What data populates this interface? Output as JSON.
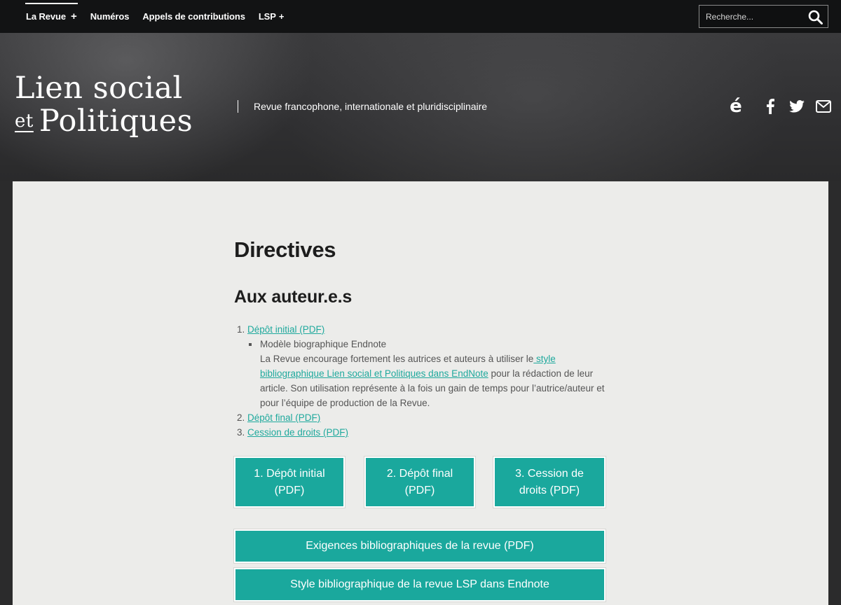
{
  "nav": {
    "items": [
      {
        "label": "La Revue",
        "plus": "+"
      },
      {
        "label": "Numéros"
      },
      {
        "label": "Appels de contributions"
      },
      {
        "label": "LSP",
        "plus": "+"
      }
    ]
  },
  "search": {
    "placeholder": "Recherche..."
  },
  "header": {
    "logo_line1": "Lien social",
    "logo_et": "et",
    "logo_line2": "Politiques",
    "tagline": "Revue francophone, internationale et pluridisciplinaire",
    "erudit_glyph": "é"
  },
  "content": {
    "title": "Directives",
    "subtitle": "Aux auteur.e.s",
    "list": [
      {
        "num": "1.",
        "link": "Dépôt initial (PDF)"
      },
      {
        "num": "2.",
        "link": "Dépôt final (PDF)"
      },
      {
        "num": "3.",
        "link": "Cession de droits (PDF)"
      }
    ],
    "sub_item": {
      "title": "Modèle biographique Endnote",
      "text_before": "La Revue encourage fortement les autrices et auteurs à utiliser le",
      "link": " style bibliographique Lien social et Politiques dans EndNote",
      "text_after": " pour la rédaction de leur article. Son utilisation représente à la fois un gain de temps pour l’autrice/auteur et pour l’équipe de production de la Revue."
    },
    "buttons": [
      "1. Dépôt initial (PDF)",
      "2. Dépôt final (PDF)",
      "3. Cession de droits (PDF)"
    ],
    "wide_buttons": [
      "Exigences bibliographiques de la revue (PDF)",
      "Style bibliographique de la revue LSP dans Endnote"
    ]
  },
  "colors": {
    "accent": "#1aa89d",
    "link": "#1fa99d",
    "topbar": "#121314"
  }
}
